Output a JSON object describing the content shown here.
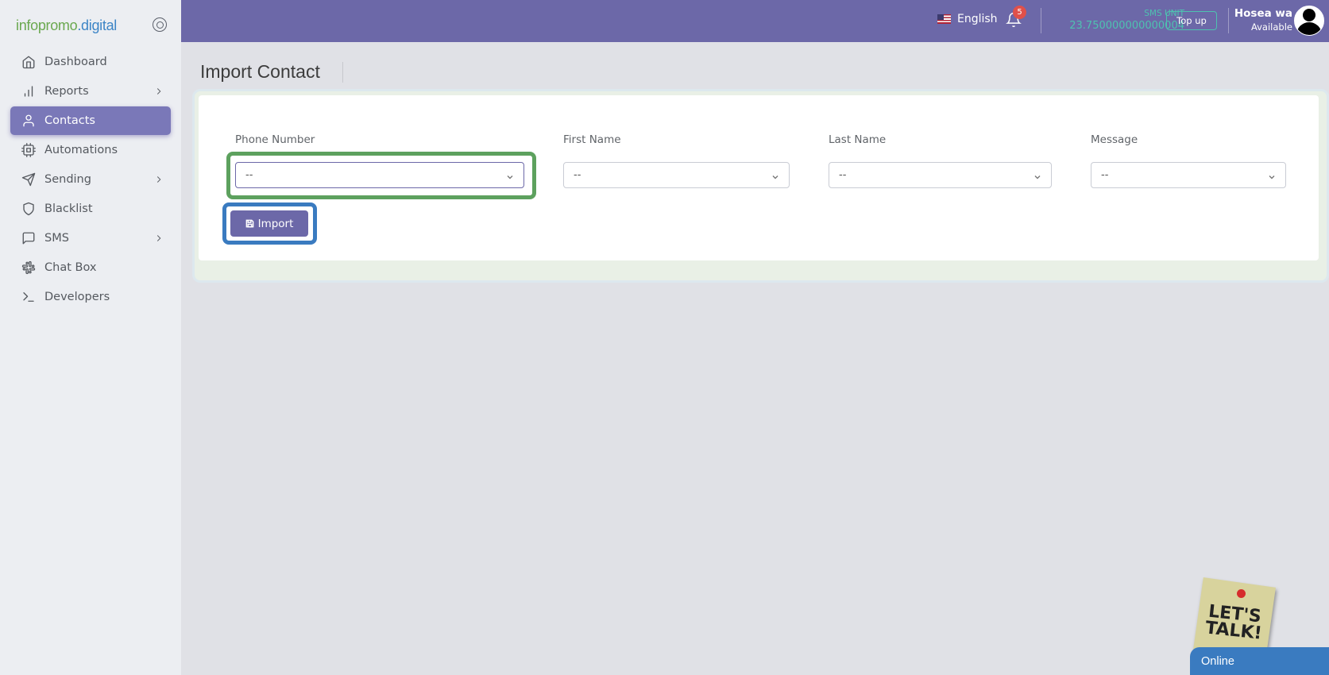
{
  "brand": {
    "part1": "infopromo",
    "part2": ".digital"
  },
  "sidebar": {
    "items": [
      {
        "label": "Dashboard",
        "icon": "home-icon",
        "has_submenu": false,
        "active": false
      },
      {
        "label": "Reports",
        "icon": "bar-chart-icon",
        "has_submenu": true,
        "active": false
      },
      {
        "label": "Contacts",
        "icon": "user-icon",
        "has_submenu": false,
        "active": true
      },
      {
        "label": "Automations",
        "icon": "cpu-icon",
        "has_submenu": false,
        "active": false
      },
      {
        "label": "Sending",
        "icon": "send-icon",
        "has_submenu": true,
        "active": false
      },
      {
        "label": "Blacklist",
        "icon": "shield-icon",
        "has_submenu": false,
        "active": false
      },
      {
        "label": "SMS",
        "icon": "message-square-icon",
        "has_submenu": true,
        "active": false
      },
      {
        "label": "Chat Box",
        "icon": "slack-icon",
        "has_submenu": false,
        "active": false
      },
      {
        "label": "Developers",
        "icon": "terminal-icon",
        "has_submenu": false,
        "active": false
      }
    ]
  },
  "topbar": {
    "language": "English",
    "notification_count": "5",
    "sms_unit_label": "SMS UNIT",
    "sms_unit_value": "23.750000000000004",
    "topup_label": "Top up",
    "user_name": "Hosea wa",
    "user_status": "Available"
  },
  "main": {
    "page_title": "Import Contact",
    "fields": [
      {
        "label": "Phone Number",
        "value": "--"
      },
      {
        "label": "First Name",
        "value": "--"
      },
      {
        "label": "Last Name",
        "value": "--"
      },
      {
        "label": "Message",
        "value": "--"
      }
    ],
    "import_button": "Import"
  },
  "chat_widget": {
    "note_text": "LET'S\nTALK!",
    "status": "Online"
  },
  "colors": {
    "primary": "#6c68a8",
    "accent_teal": "#4ec2b0",
    "highlight_green": "#5da15e",
    "highlight_blue": "#3a7bc0",
    "badge_red": "#e0504a"
  }
}
